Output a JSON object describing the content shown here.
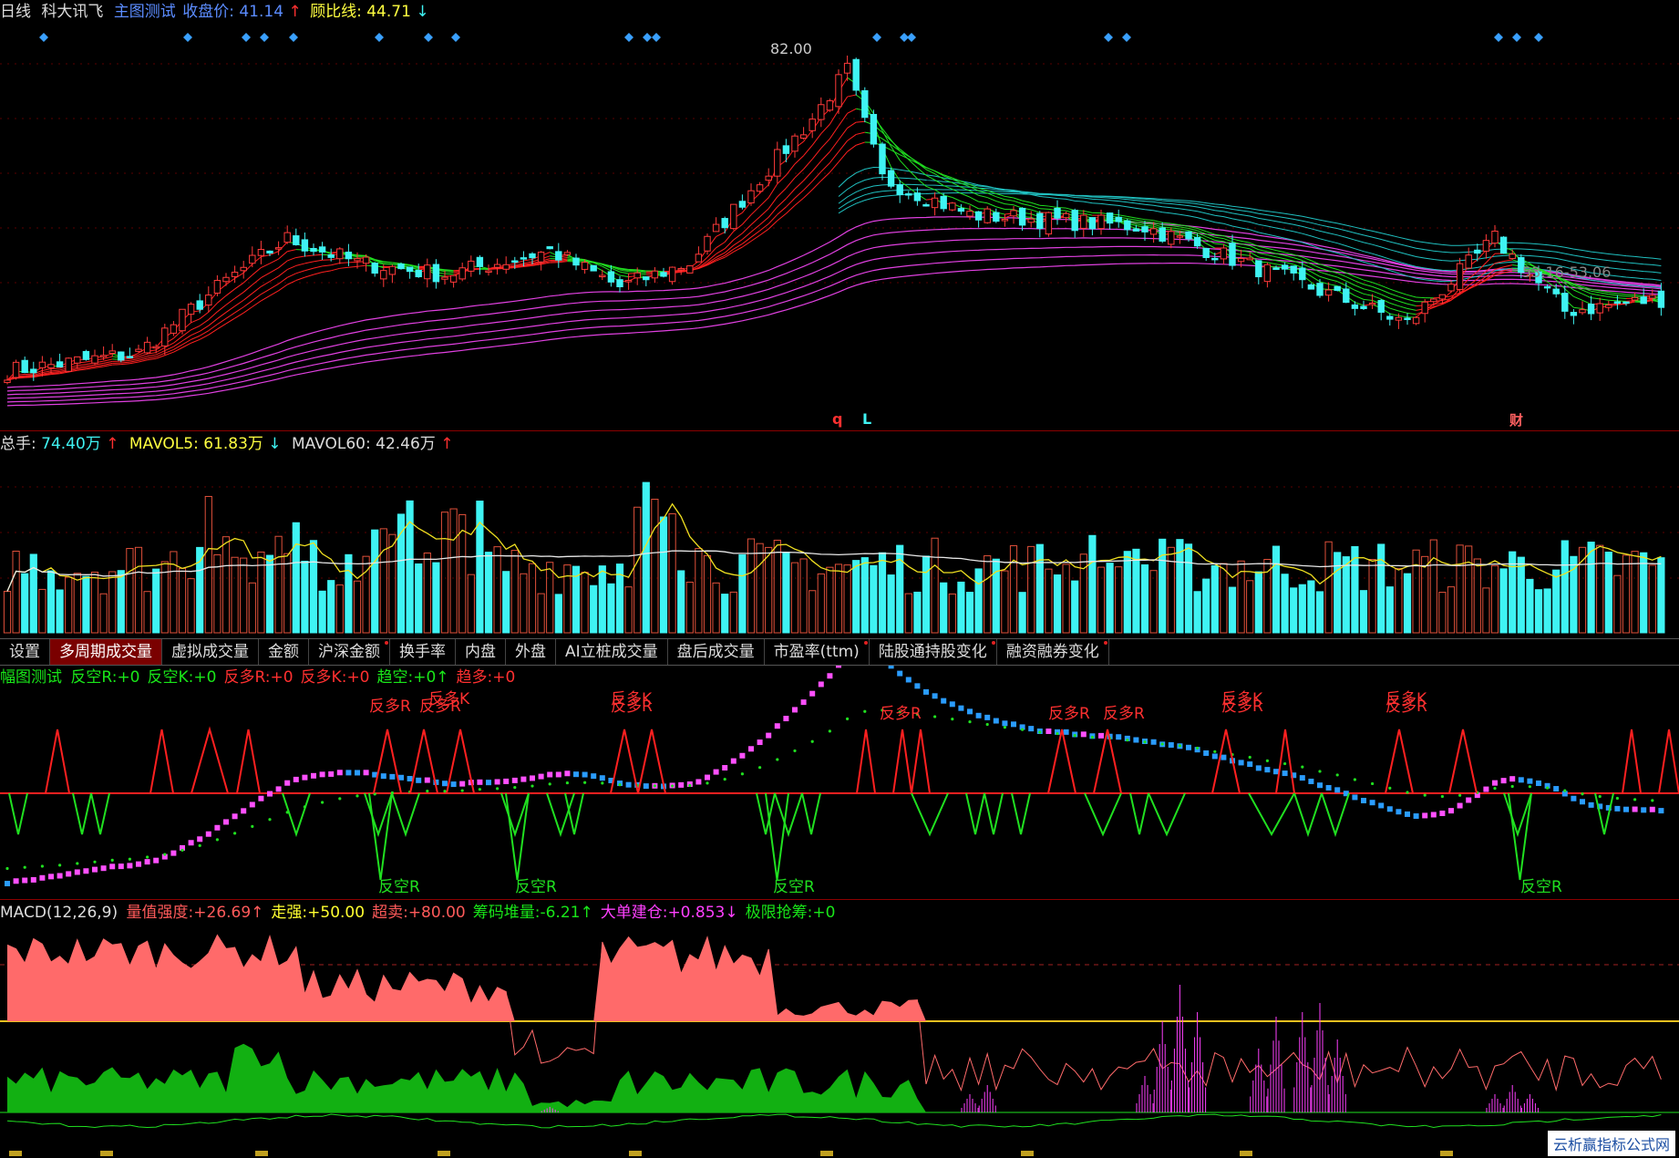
{
  "main_panel": {
    "period": "日线",
    "stock_name": "科大讯飞",
    "indicator": "主图测试",
    "close_label": "收盘价:",
    "close_value": "41.14",
    "close_arrow": "↑",
    "guppy_label": "顾比线:",
    "guppy_value": "44.71",
    "guppy_arrow": "↓",
    "high_label": "82.00",
    "range_label": "53.16-53.06",
    "markers": [
      "q",
      "L",
      "财"
    ]
  },
  "volume_panel": {
    "total_label": "总手:",
    "total_value": "74.40万",
    "total_arrow": "↑",
    "mavol5_label": "MAVOL5:",
    "mavol5_value": "61.83万",
    "mavol5_arrow": "↓",
    "mavol60_label": "MAVOL60:",
    "mavol60_value": "42.46万",
    "mavol60_arrow": "↑"
  },
  "tabs": [
    {
      "label": "设置",
      "active": false,
      "dot": false
    },
    {
      "label": "多周期成交量",
      "active": true,
      "dot": false
    },
    {
      "label": "虚拟成交量",
      "active": false,
      "dot": false
    },
    {
      "label": "金额",
      "active": false,
      "dot": false
    },
    {
      "label": "沪深金额",
      "active": false,
      "dot": true
    },
    {
      "label": "换手率",
      "active": false,
      "dot": false
    },
    {
      "label": "内盘",
      "active": false,
      "dot": false
    },
    {
      "label": "外盘",
      "active": false,
      "dot": false
    },
    {
      "label": "AI立桩成交量",
      "active": false,
      "dot": false
    },
    {
      "label": "盘后成交量",
      "active": false,
      "dot": false
    },
    {
      "label": "市盈率(ttm)",
      "active": false,
      "dot": true
    },
    {
      "label": "陆股通持股变化",
      "active": false,
      "dot": true
    },
    {
      "label": "融资融券变化",
      "active": false,
      "dot": true
    }
  ],
  "signal_panel": {
    "title": "幅图测试",
    "items": [
      {
        "label": "反空R:",
        "value": "+0",
        "color": "#19e619"
      },
      {
        "label": "反空K:",
        "value": "+0",
        "color": "#19e619"
      },
      {
        "label": "反多R:",
        "value": "+0",
        "color": "#ff3030"
      },
      {
        "label": "反多K:",
        "value": "+0",
        "color": "#ff3030"
      },
      {
        "label": "趋空:",
        "value": "+0↑",
        "color": "#19e619"
      },
      {
        "label": "趋多:",
        "value": "+0",
        "color": "#ff3030"
      }
    ],
    "buy_label": "反多R",
    "buy_label_k": "反多K",
    "sell_label": "反空R"
  },
  "macd_panel": {
    "title": "MACD(12,26,9)",
    "items": [
      {
        "label": "量值强度:",
        "value": "+26.69↑",
        "color": "#ff5a5a"
      },
      {
        "label": "走强:",
        "value": "+50.00",
        "color": "#ffff30"
      },
      {
        "label": "超卖:",
        "value": "+80.00",
        "color": "#ff5a5a"
      },
      {
        "label": "筹码堆量:",
        "value": "-6.21↑",
        "color": "#19e619"
      },
      {
        "label": "大单建仓:",
        "value": "+0.853↓",
        "color": "#ff40ff"
      },
      {
        "label": "极限抢筹:",
        "value": "+0",
        "color": "#19e619"
      }
    ]
  },
  "watermark": "云析赢指标公式网",
  "colors": {
    "up": "#ff3a3a",
    "down": "#3ff3f3",
    "bull_ribbon": "#ff2020",
    "bear_ribbon": "#20e020",
    "long_ribbon": "#e040e0",
    "teal_ribbon": "#20c0c0",
    "separator": "#8b0000"
  }
}
